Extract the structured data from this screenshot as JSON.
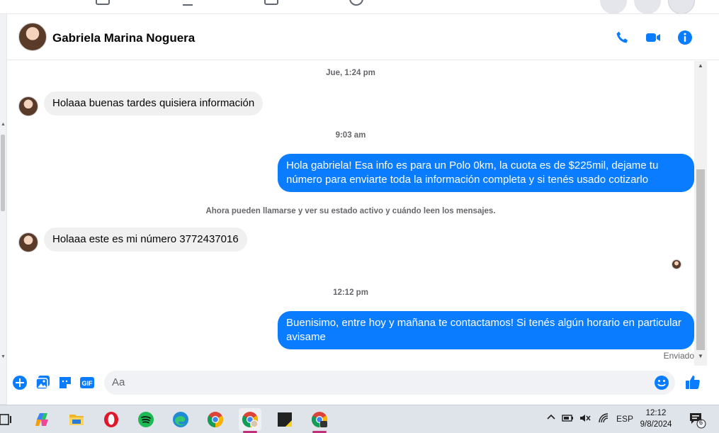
{
  "contact": {
    "name": "Gabriela Marina Noguera"
  },
  "messages": [
    {
      "kind": "timestamp",
      "text": "Jue, 1:24 pm"
    },
    {
      "kind": "incoming",
      "text": "Holaaa buenas tardes quisiera información"
    },
    {
      "kind": "timestamp",
      "text": "9:03 am"
    },
    {
      "kind": "outgoing",
      "text": "Hola gabriela! Esa info es para un Polo 0km, la cuota es de $225mil, dejame tu número para enviarte toda la información completa y si tenés usado cotizarlo"
    },
    {
      "kind": "notice",
      "text": "Ahora pueden llamarse y ver su estado activo y cuándo leen los mensajes."
    },
    {
      "kind": "incoming",
      "text": "Holaaa este es mi número 3772437016"
    },
    {
      "kind": "timestamp",
      "text": "12:12 pm"
    },
    {
      "kind": "outgoing",
      "text": "Buenisimo, entre hoy y mañana te contactamos! Si tenés algún horario en particular avisame"
    }
  ],
  "status": {
    "sent": "Enviado"
  },
  "composer": {
    "placeholder": "Aa",
    "gif_label": "GIF"
  },
  "header_icons": [
    "phone-icon",
    "video-camera-icon",
    "info-icon"
  ],
  "composer_icons": [
    "plus-icon",
    "image-icon",
    "sticker-icon",
    "gif-icon",
    "emoji-icon",
    "thumbs-up-icon"
  ],
  "taskbar": {
    "apps": [
      "task-view-icon",
      "copilot-icon",
      "file-explorer-icon",
      "opera-icon",
      "spotify-icon",
      "edge-icon",
      "chrome-icon",
      "chrome-profile-icon",
      "sticky-notes-icon",
      "chrome-profile-2-icon"
    ],
    "language": "ESP",
    "time": "12:12",
    "date": "9/8/2024",
    "notification_count": "6"
  },
  "colors": {
    "accent": "#0a7cff",
    "incoming_bubble": "#f0f0f0",
    "text_secondary": "#65676b"
  }
}
